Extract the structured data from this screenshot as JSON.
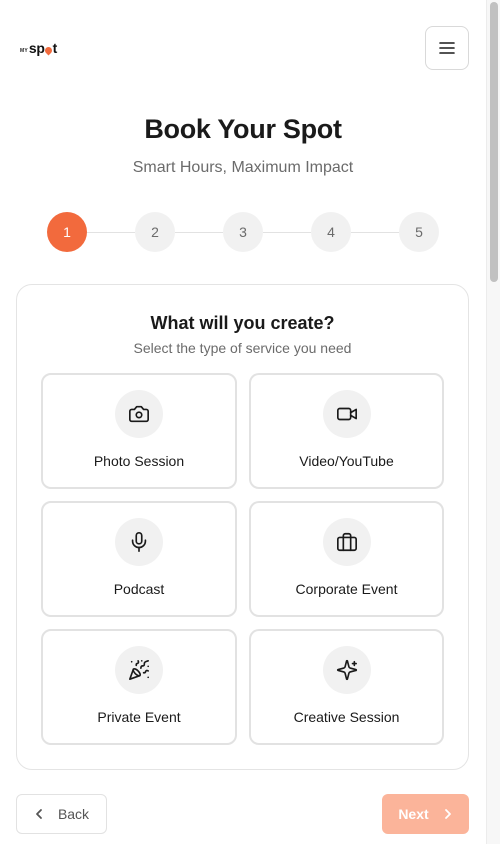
{
  "header": {
    "logo_small": "MY",
    "logo_main_pre": "sp",
    "logo_main_post": "t",
    "menu_icon": "hamburger-menu-icon"
  },
  "hero": {
    "title": "Book Your Spot",
    "subtitle": "Smart Hours, Maximum Impact"
  },
  "stepper": {
    "steps": [
      "1",
      "2",
      "3",
      "4",
      "5"
    ],
    "current": 1,
    "active_color": "#f26a3d"
  },
  "service_card": {
    "title": "What will you create?",
    "subtitle": "Select the type of service you need",
    "options": [
      {
        "label": "Photo Session",
        "icon": "camera-icon"
      },
      {
        "label": "Video/YouTube",
        "icon": "video-camera-icon"
      },
      {
        "label": "Podcast",
        "icon": "microphone-icon"
      },
      {
        "label": "Corporate Event",
        "icon": "briefcase-icon"
      },
      {
        "label": "Private Event",
        "icon": "party-popper-icon"
      },
      {
        "label": "Creative Session",
        "icon": "sparkles-icon"
      }
    ]
  },
  "footer": {
    "back_label": "Back",
    "next_label": "Next",
    "next_color": "#fbb49a"
  }
}
